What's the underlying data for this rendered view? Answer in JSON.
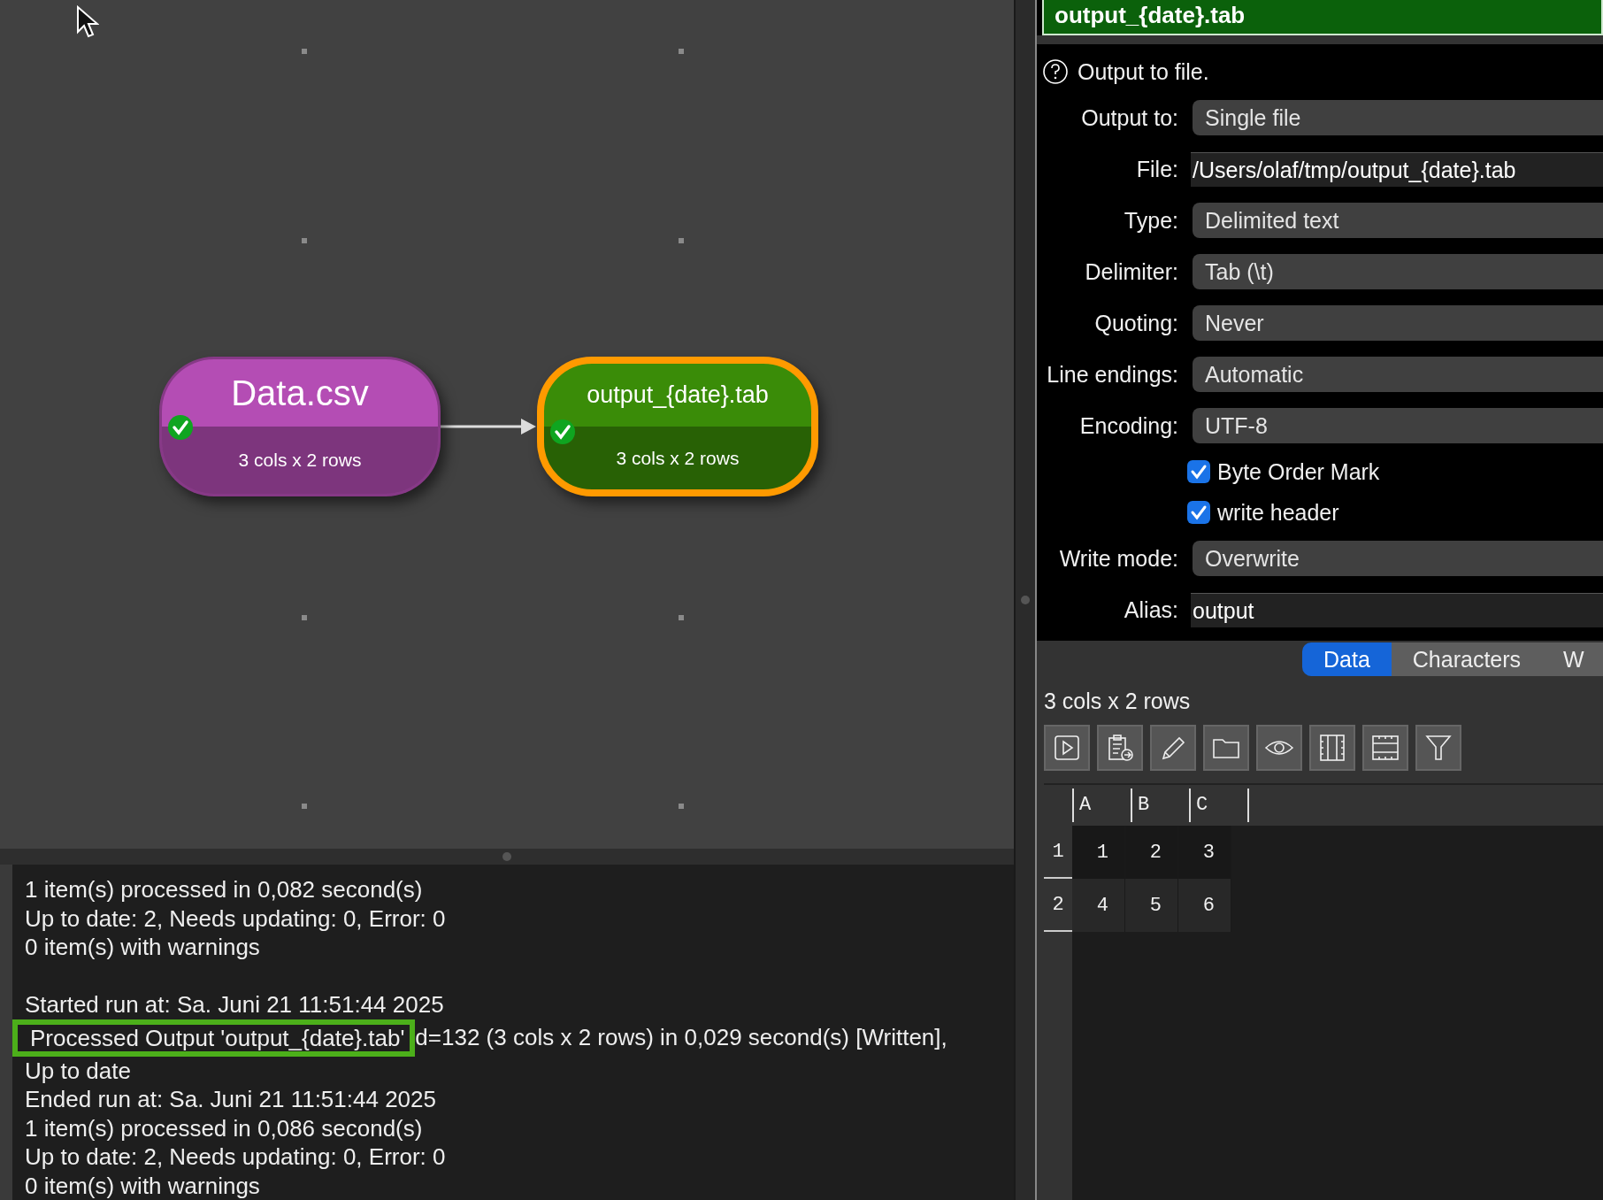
{
  "canvas": {
    "nodes": [
      {
        "title": "Data.csv",
        "subtitle": "3 cols x 2 rows",
        "color": "#b44db4",
        "complete": true,
        "selected": false
      },
      {
        "title": "output_{date}.tab",
        "subtitle": "3 cols x 2 rows",
        "color": "#3a8c08",
        "complete": true,
        "selected": true
      }
    ]
  },
  "inspector": {
    "title": "output_{date}.tab",
    "description": "Output to file.",
    "fields": [
      {
        "kind": "dropdown",
        "label": "Output to:",
        "value": "Single file"
      },
      {
        "kind": "text",
        "label": "File:",
        "value": "/Users/olaf/tmp/output_{date}.tab"
      },
      {
        "kind": "dropdown",
        "label": "Type:",
        "value": "Delimited text"
      },
      {
        "kind": "dropdown",
        "label": "Delimiter:",
        "value": "Tab (\\t)"
      },
      {
        "kind": "dropdown",
        "label": "Quoting:",
        "value": "Never"
      },
      {
        "kind": "dropdown",
        "label": "Line endings:",
        "value": "Automatic"
      },
      {
        "kind": "dropdown",
        "label": "Encoding:",
        "value": "UTF-8"
      },
      {
        "kind": "checkbox",
        "label": "Byte Order Mark",
        "checked": true
      },
      {
        "kind": "checkbox",
        "label": "write header",
        "checked": true
      },
      {
        "kind": "dropdown",
        "label": "Write mode:",
        "value": "Overwrite"
      },
      {
        "kind": "text",
        "label": "Alias:",
        "value": "output"
      }
    ]
  },
  "tabs": [
    {
      "label": "Data",
      "selected": true
    },
    {
      "label": "Characters",
      "selected": false
    },
    {
      "label": "W",
      "selected": false
    }
  ],
  "data_view": {
    "summary": "3 cols x 2 rows",
    "columns": [
      "A",
      "B",
      "C"
    ],
    "rows": [
      {
        "header": "1",
        "cells": [
          "1",
          "2",
          "3"
        ]
      },
      {
        "header": "2",
        "cells": [
          "4",
          "5",
          "6"
        ]
      }
    ]
  },
  "log": {
    "lines": [
      {
        "kind": "text",
        "text": "1 item(s) processed in 0,082 second(s)"
      },
      {
        "kind": "text",
        "text": "Up to date: 2, Needs updating: 0, Error: 0"
      },
      {
        "kind": "text",
        "text": "0 item(s) with warnings"
      },
      {
        "kind": "blank"
      },
      {
        "kind": "text",
        "text": "Started run at: Sa. Juni 21 11:51:44 2025"
      },
      {
        "kind": "highlight",
        "callout": "Processed Output 'output_{date}.tab'",
        "text": "d=132 (3 cols x 2 rows) in 0,029 second(s) [Written],"
      },
      {
        "kind": "text",
        "text": "Up to date"
      },
      {
        "kind": "text",
        "text": "Ended run at: Sa. Juni 21 11:51:44 2025"
      },
      {
        "kind": "text",
        "text": "1 item(s) processed in 0,086 second(s)"
      },
      {
        "kind": "text",
        "text": "Up to date: 2, Needs updating: 0, Error: 0"
      },
      {
        "kind": "text",
        "text": "0 item(s) with warnings"
      }
    ]
  }
}
